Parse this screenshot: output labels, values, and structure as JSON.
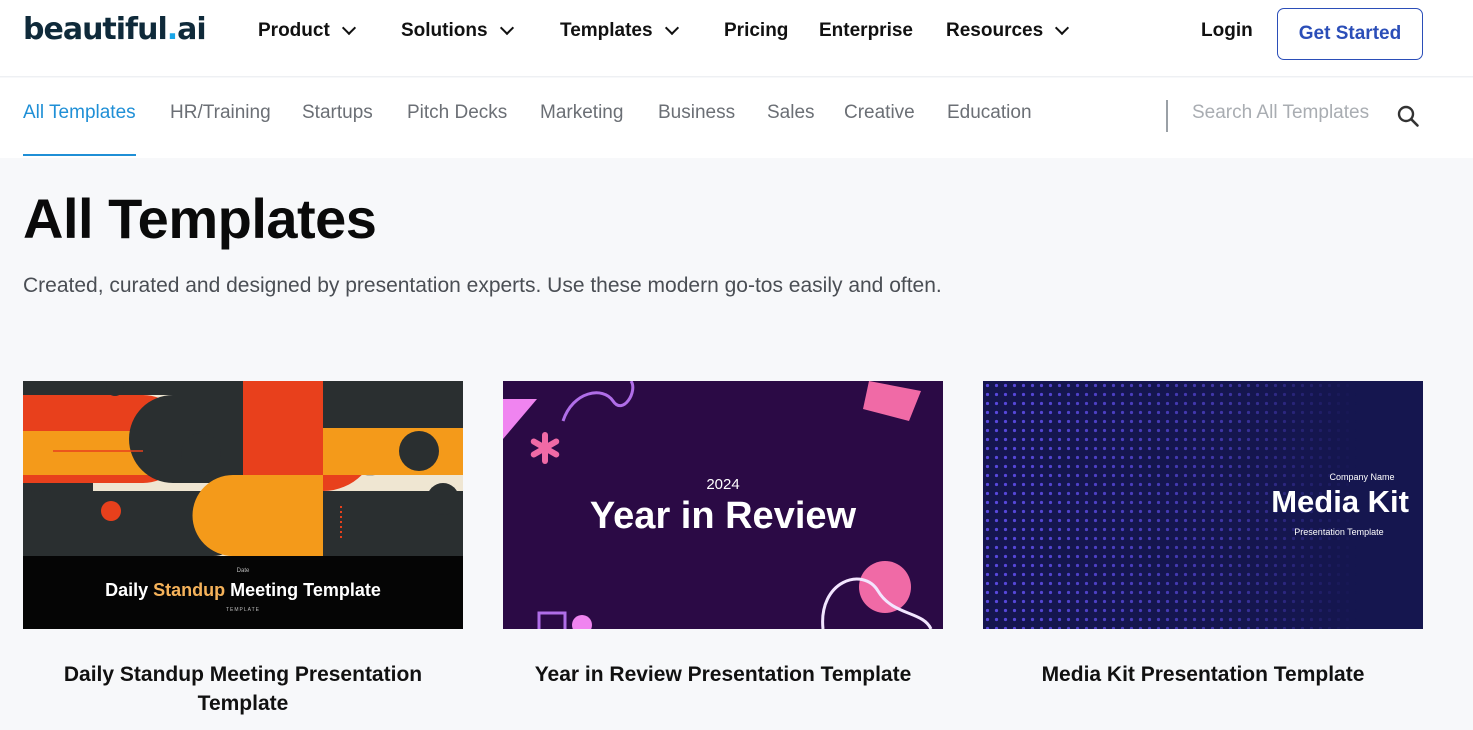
{
  "header": {
    "logo_main": "beautiful",
    "logo_dot": ".",
    "logo_suffix": "ai",
    "nav": {
      "product": "Product",
      "solutions": "Solutions",
      "templates": "Templates",
      "pricing": "Pricing",
      "enterprise": "Enterprise",
      "resources": "Resources"
    },
    "login": "Login",
    "get_started": "Get Started"
  },
  "subnav": {
    "categories": {
      "all": "All Templates",
      "hr": "HR/Training",
      "startups": "Startups",
      "pitch": "Pitch Decks",
      "marketing": "Marketing",
      "business": "Business",
      "sales": "Sales",
      "creative": "Creative",
      "education": "Education"
    },
    "active": "All Templates",
    "search_placeholder": "Search All Templates"
  },
  "page": {
    "title": "All Templates",
    "subtitle": "Created, curated and designed by presentation experts. Use these modern go-tos easily and often."
  },
  "cards": [
    {
      "title": "Daily Standup Meeting Presentation Template",
      "thumb": {
        "date": "Date",
        "pre": "Daily ",
        "highlight": "Standup",
        "post": " Meeting Template",
        "tag": "TEMPLATE"
      }
    },
    {
      "title": "Year in Review Presentation Template",
      "thumb": {
        "year": "2024",
        "title": "Year in Review"
      }
    },
    {
      "title": "Media Kit Presentation Template",
      "thumb": {
        "company": "Company Name",
        "title": "Media Kit",
        "subtitle": "Presentation Template"
      }
    }
  ],
  "colors": {
    "accent": "#1f8fd6",
    "button_border": "#2b4eb8",
    "page_bg": "#f7f8fa",
    "standup_highlight": "#f5b25a",
    "year_review_bg": "#2b0a45",
    "media_kit_bg": "#15164f"
  }
}
